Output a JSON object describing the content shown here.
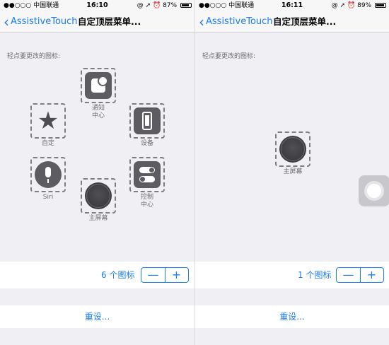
{
  "left": {
    "status": {
      "carrier": "●●○○○ 中国联通",
      "time": "16:10",
      "battery": "87%",
      "battery_level": 0.87,
      "right_icons": "@ ➚ ⏰"
    },
    "nav": {
      "back_label": "AssistiveTouch",
      "title": "自定顶层菜单..."
    },
    "hint": "轻点要更改的图标:",
    "icons": [
      {
        "name": "notifications",
        "label_line1": "通知",
        "label_line2": "中心"
      },
      {
        "name": "custom",
        "label_line1": "自定"
      },
      {
        "name": "device",
        "label_line1": "设备"
      },
      {
        "name": "siri",
        "label_line1": "Siri"
      },
      {
        "name": "control-center",
        "label_line1": "控制",
        "label_line2": "中心"
      },
      {
        "name": "home",
        "label_line1": "主屏幕"
      }
    ],
    "count_label": "6 个图标",
    "stepper": {
      "minus": "—",
      "plus": "+"
    },
    "reset_label": "重设..."
  },
  "right": {
    "status": {
      "carrier": "●●○○○ 中国联通",
      "time": "16:11",
      "battery": "89%",
      "battery_level": 0.89,
      "right_icons": "@ ➚ ⏰"
    },
    "nav": {
      "back_label": "AssistiveTouch",
      "title": "自定顶层菜单..."
    },
    "hint": "轻点要更改的图标:",
    "icons": [
      {
        "name": "home",
        "label_line1": "主屏幕"
      }
    ],
    "count_label": "1 个图标",
    "stepper": {
      "minus": "—",
      "plus": "+"
    },
    "reset_label": "重设..."
  },
  "colors": {
    "accent": "#1a7cf5",
    "background": "#efeff4",
    "tile": "#5c5c61"
  }
}
